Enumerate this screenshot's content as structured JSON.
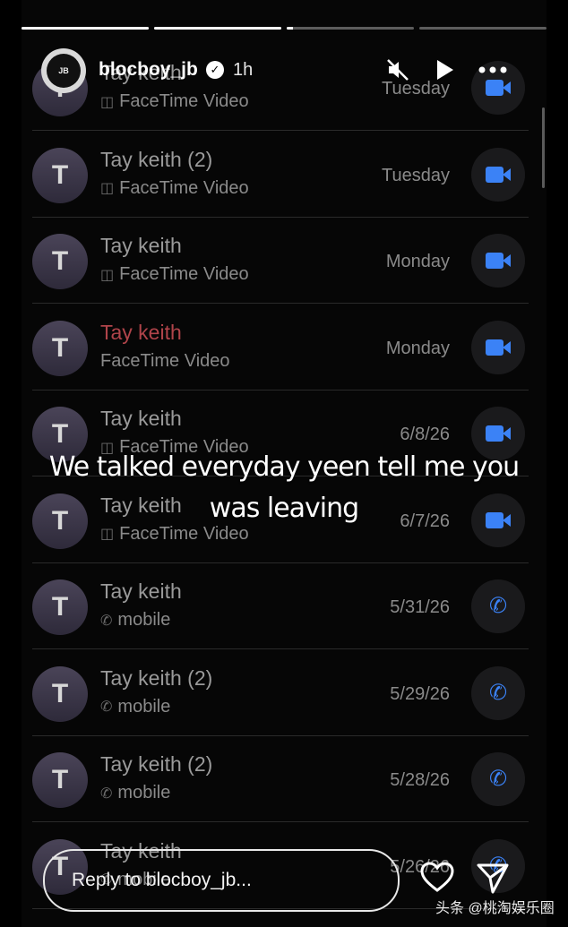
{
  "story": {
    "username": "blocboy_jb",
    "time_ago": "1h",
    "caption_line1": "We talked everyday yeen tell me you",
    "caption_line2": "was leaving",
    "reply_placeholder": "Reply to blocboy_jb...",
    "progress": [
      1.0,
      1.0,
      0.05,
      0.0
    ]
  },
  "calls": [
    {
      "name": "Tay keith",
      "sub": "FaceTime Video",
      "date": "Tuesday",
      "kind": "video",
      "missed": false
    },
    {
      "name": "Tay keith (2)",
      "sub": "FaceTime Video",
      "date": "Tuesday",
      "kind": "video",
      "missed": false
    },
    {
      "name": "Tay keith",
      "sub": "FaceTime Video",
      "date": "Monday",
      "kind": "video",
      "missed": false
    },
    {
      "name": "Tay keith",
      "sub": "FaceTime Video",
      "date": "Monday",
      "kind": "video",
      "missed": true
    },
    {
      "name": "Tay keith",
      "sub": "FaceTime Video",
      "date": "6/8/26",
      "kind": "video",
      "missed": false
    },
    {
      "name": "Tay keith",
      "sub": "FaceTime Video",
      "date": "6/7/26",
      "kind": "video",
      "missed": false
    },
    {
      "name": "Tay keith",
      "sub": "mobile",
      "date": "5/31/26",
      "kind": "phone",
      "missed": false
    },
    {
      "name": "Tay keith (2)",
      "sub": "mobile",
      "date": "5/29/26",
      "kind": "phone",
      "missed": false
    },
    {
      "name": "Tay keith (2)",
      "sub": "mobile",
      "date": "5/28/26",
      "kind": "phone",
      "missed": false
    },
    {
      "name": "Tay keith",
      "sub": "mobile",
      "date": "5/26/26",
      "kind": "phone",
      "missed": false
    }
  ],
  "avatar_letter": "T",
  "watermark": "头条 @桃淘娱乐圈",
  "icons": {
    "mute": "muted-speaker-icon",
    "play": "play-icon",
    "more": "more-dots-icon",
    "like": "heart-icon",
    "share": "send-icon",
    "verified": "verified-badge-icon"
  },
  "colors": {
    "accent": "#3b82f6",
    "missed": "#b0444a"
  }
}
